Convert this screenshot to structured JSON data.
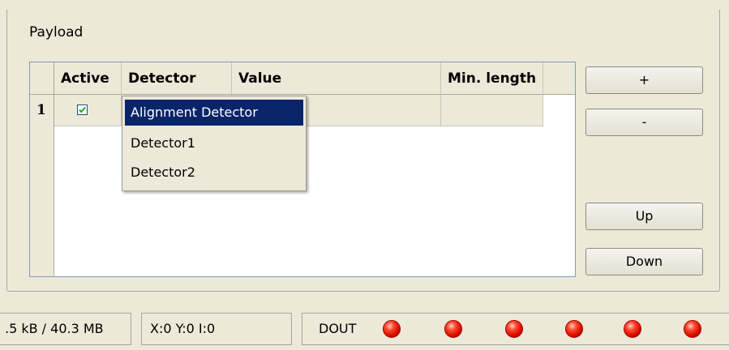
{
  "payload": {
    "title": "Payload",
    "grid": {
      "columns": [
        "Active",
        "Detector",
        "Value",
        "Min. length"
      ],
      "rows": [
        {
          "index": "1",
          "active": true,
          "detector": "",
          "value": "",
          "min_length": ""
        }
      ]
    },
    "dropdown": {
      "options": [
        "Alignment Detector",
        "Detector1",
        "Detector2"
      ],
      "selected": "Alignment Detector"
    },
    "buttons": {
      "add": "+",
      "remove": "-",
      "up": "Up",
      "down": "Down"
    }
  },
  "statusbar": {
    "memory": ".5 kB / 40.3 MB",
    "coords": "X:0 Y:0 I:0",
    "dout_label": "DOUT",
    "led_color": "#e01000",
    "leds": [
      true,
      true,
      true,
      true,
      true,
      true
    ]
  }
}
